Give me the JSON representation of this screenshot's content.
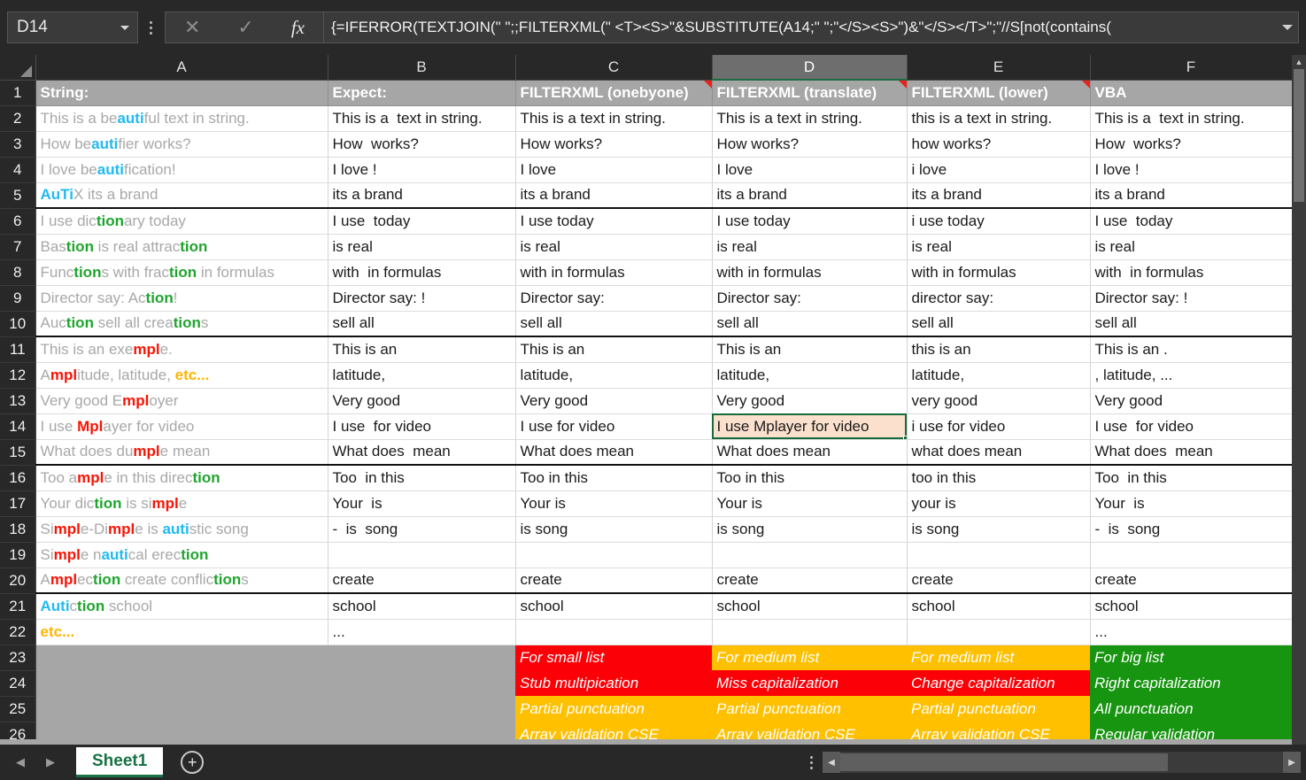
{
  "formula_bar": {
    "name_box_value": "D14",
    "cancel_icon": "close-icon",
    "confirm_icon": "check-icon",
    "fx_label": "fx",
    "formula": "{=IFERROR(TEXTJOIN(\" \";;FILTERXML(\"  <T><S>\"&SUBSTITUTE(A14;\" \";\"</S><S>\")&\"</S></T>\";\"//S[not(contains("
  },
  "columns": [
    {
      "letter": "A",
      "selected": false
    },
    {
      "letter": "B",
      "selected": false
    },
    {
      "letter": "C",
      "selected": false
    },
    {
      "letter": "D",
      "selected": true
    },
    {
      "letter": "E",
      "selected": false
    },
    {
      "letter": "F",
      "selected": false
    }
  ],
  "header_row": {
    "A": "String:",
    "B": "Expect:",
    "C": "FILTERXML (onebyone)",
    "D": "FILTERXML (translate)",
    "E": "FILTERXML (lower)",
    "F": "VBA",
    "comment_columns": [
      "C",
      "D",
      "E"
    ]
  },
  "rows": [
    {
      "n": 2,
      "a": [
        [
          "This is a be",
          ""
        ],
        [
          "auti",
          "cyan"
        ],
        [
          "ful text in string.",
          ""
        ]
      ],
      "b": "This is a  text in string.",
      "c": "This is a text in string.",
      "d": "This is a text in string.",
      "e": "this is a text in string.",
      "f": "This is a  text in string."
    },
    {
      "n": 3,
      "a": [
        [
          "How be",
          ""
        ],
        [
          "auti",
          "cyan"
        ],
        [
          "fier works?",
          ""
        ]
      ],
      "b": "How  works?",
      "c": "How works?",
      "d": "How works?",
      "e": "how works?",
      "f": "How  works?"
    },
    {
      "n": 4,
      "a": [
        [
          "I love be",
          ""
        ],
        [
          "auti",
          "cyan"
        ],
        [
          "fication!",
          ""
        ]
      ],
      "b": "I love !",
      "c": "I love",
      "d": "I love",
      "e": "i love",
      "f": "I love !"
    },
    {
      "n": 5,
      "a": [
        [
          "AuTi",
          "cyan"
        ],
        [
          "X its a brand",
          ""
        ]
      ],
      "b": "its a brand",
      "c": "its a brand",
      "d": "its a brand",
      "e": "its a brand",
      "f": "its a brand",
      "thick": true
    },
    {
      "n": 6,
      "a": [
        [
          "I use dic",
          ""
        ],
        [
          "tion",
          "green"
        ],
        [
          "ary today",
          ""
        ]
      ],
      "b": "I use  today",
      "c": "I use today",
      "d": "I use today",
      "e": "i use today",
      "f": "I use  today"
    },
    {
      "n": 7,
      "a": [
        [
          "Bas",
          ""
        ],
        [
          "tion",
          "green"
        ],
        [
          " is real attrac",
          ""
        ],
        [
          "tion",
          "green"
        ]
      ],
      "b": "is real",
      "c": "is real",
      "d": "is real",
      "e": "is real",
      "f": "is real"
    },
    {
      "n": 8,
      "a": [
        [
          "Func",
          ""
        ],
        [
          "tion",
          "green"
        ],
        [
          "s with frac",
          ""
        ],
        [
          "tion",
          "green"
        ],
        [
          " in formulas",
          ""
        ]
      ],
      "b": "with  in formulas",
      "c": "with in formulas",
      "d": "with in formulas",
      "e": "with in formulas",
      "f": "with  in formulas"
    },
    {
      "n": 9,
      "a": [
        [
          "Director say: Ac",
          ""
        ],
        [
          "tion",
          "green"
        ],
        [
          "!",
          ""
        ]
      ],
      "b": "Director say: !",
      "c": "Director say:",
      "d": "Director say:",
      "e": "director say:",
      "f": "Director say: !"
    },
    {
      "n": 10,
      "a": [
        [
          "Auc",
          ""
        ],
        [
          "tion",
          "green"
        ],
        [
          " sell all crea",
          ""
        ],
        [
          "tion",
          "green"
        ],
        [
          "s",
          ""
        ]
      ],
      "b": "sell all",
      "c": "sell all",
      "d": "sell all",
      "e": "sell all",
      "f": "sell all",
      "thick": true
    },
    {
      "n": 11,
      "a": [
        [
          "This is an exe",
          ""
        ],
        [
          "mpl",
          "red"
        ],
        [
          "e.",
          ""
        ]
      ],
      "b": "This is an",
      "c": "This is an",
      "d": "This is an",
      "e": "this is an",
      "f": "This is an ."
    },
    {
      "n": 12,
      "a": [
        [
          "A",
          ""
        ],
        [
          "mpl",
          "red"
        ],
        [
          "itude, latitude, ",
          ""
        ],
        [
          "etc",
          "orange"
        ],
        [
          "...",
          "orange"
        ]
      ],
      "b": "latitude,",
      "c": "latitude,",
      "d": "latitude,",
      "e": "latitude,",
      "f": ", latitude, ..."
    },
    {
      "n": 13,
      "a": [
        [
          "Very good E",
          ""
        ],
        [
          "mpl",
          "red"
        ],
        [
          "oyer",
          ""
        ]
      ],
      "b": "Very good",
      "c": "Very good",
      "d": "Very good",
      "e": "very good",
      "f": "Very good"
    },
    {
      "n": 14,
      "a": [
        [
          "I use ",
          ""
        ],
        [
          "Mpl",
          "red"
        ],
        [
          "ayer for video",
          ""
        ]
      ],
      "b": "I use  for video",
      "c": "I use for video",
      "d": "I use Mplayer for video",
      "e": "i use for video",
      "f": "I use  for video",
      "active": "D"
    },
    {
      "n": 15,
      "a": [
        [
          "What does du",
          ""
        ],
        [
          "mpl",
          "red"
        ],
        [
          "e mean",
          ""
        ]
      ],
      "b": "What does  mean",
      "c": "What does mean",
      "d": "What does mean",
      "e": "what does mean",
      "f": "What does  mean",
      "thick": true
    },
    {
      "n": 16,
      "a": [
        [
          "Too a",
          ""
        ],
        [
          "mpl",
          "red"
        ],
        [
          "e in this direc",
          ""
        ],
        [
          "tion",
          "green"
        ]
      ],
      "b": "Too  in this",
      "c": "Too in this",
      "d": "Too in this",
      "e": "too in this",
      "f": "Too  in this"
    },
    {
      "n": 17,
      "a": [
        [
          "Your dic",
          ""
        ],
        [
          "tion",
          "green"
        ],
        [
          " is si",
          ""
        ],
        [
          "mpl",
          "red"
        ],
        [
          "e",
          ""
        ]
      ],
      "b": "Your  is",
      "c": "Your is",
      "d": "Your is",
      "e": "your is",
      "f": "Your  is"
    },
    {
      "n": 18,
      "a": [
        [
          "Si",
          ""
        ],
        [
          "mpl",
          "red"
        ],
        [
          "e-Di",
          ""
        ],
        [
          "mpl",
          "red"
        ],
        [
          "e is ",
          ""
        ],
        [
          "auti",
          "cyan"
        ],
        [
          "stic song",
          ""
        ]
      ],
      "b": "-  is  song",
      "c": "is song",
      "d": "is song",
      "e": "is song",
      "f": "-  is  song"
    },
    {
      "n": 19,
      "a": [
        [
          "Si",
          ""
        ],
        [
          "mpl",
          "red"
        ],
        [
          "e n",
          ""
        ],
        [
          "auti",
          "cyan"
        ],
        [
          "cal erec",
          ""
        ],
        [
          "tion",
          "green"
        ]
      ],
      "b": "",
      "c": "",
      "d": "",
      "e": "",
      "f": ""
    },
    {
      "n": 20,
      "a": [
        [
          "A",
          ""
        ],
        [
          "mpl",
          "red"
        ],
        [
          "ec",
          ""
        ],
        [
          "tion",
          "green"
        ],
        [
          " create conflic",
          ""
        ],
        [
          "tion",
          "green"
        ],
        [
          "s",
          ""
        ]
      ],
      "b": "create",
      "c": "create",
      "d": "create",
      "e": "create",
      "f": "create",
      "thick": true
    },
    {
      "n": 21,
      "a": [
        [
          "Auti",
          "cyan"
        ],
        [
          "c",
          ""
        ],
        [
          "tion",
          "green"
        ],
        [
          " school",
          ""
        ]
      ],
      "b": "school",
      "c": "school",
      "d": "school",
      "e": "school",
      "f": "school"
    },
    {
      "n": 22,
      "a": [
        [
          "etc",
          "orange"
        ],
        [
          "...",
          "orange"
        ]
      ],
      "b": "...",
      "c": "",
      "d": "",
      "e": "",
      "f": "..."
    }
  ],
  "verdicts": [
    {
      "n": 23,
      "C": {
        "text": "For small list",
        "color": "red"
      },
      "D": {
        "text": "For medium list",
        "color": "amber"
      },
      "E": {
        "text": "For medium list",
        "color": "amber"
      },
      "F": {
        "text": "For big list",
        "color": "green"
      }
    },
    {
      "n": 24,
      "C": {
        "text": "Stub multipication",
        "color": "red"
      },
      "D": {
        "text": "Miss capitalization",
        "color": "red"
      },
      "E": {
        "text": "Change capitalization",
        "color": "red"
      },
      "F": {
        "text": "Right capitalization",
        "color": "green"
      }
    },
    {
      "n": 25,
      "C": {
        "text": "Partial punctuation",
        "color": "amber"
      },
      "D": {
        "text": "Partial punctuation",
        "color": "amber"
      },
      "E": {
        "text": "Partial punctuation",
        "color": "amber"
      },
      "F": {
        "text": "All punctuation",
        "color": "green"
      }
    },
    {
      "n": 26,
      "C": {
        "text": "Array validation CSE",
        "color": "amber"
      },
      "D": {
        "text": "Array validation CSE",
        "color": "amber"
      },
      "E": {
        "text": "Array validation CSE",
        "color": "amber"
      },
      "F": {
        "text": "Regular validation",
        "color": "green"
      }
    }
  ],
  "sheetbar": {
    "prev_icon": "triangle-left-icon",
    "next_icon": "triangle-right-icon",
    "active_sheet": "Sheet1",
    "add_sheet_label": "+"
  },
  "palette": {
    "cyan": "#21b9f4",
    "green": "#1fa52e",
    "red": "#fa1405",
    "orange": "#ffb400",
    "verdict_red": "#fb0007",
    "verdict_amber": "#ffc000",
    "verdict_green": "#179410",
    "active_cell_border": "#156b3a",
    "sheet_tab_color": "#177245"
  }
}
